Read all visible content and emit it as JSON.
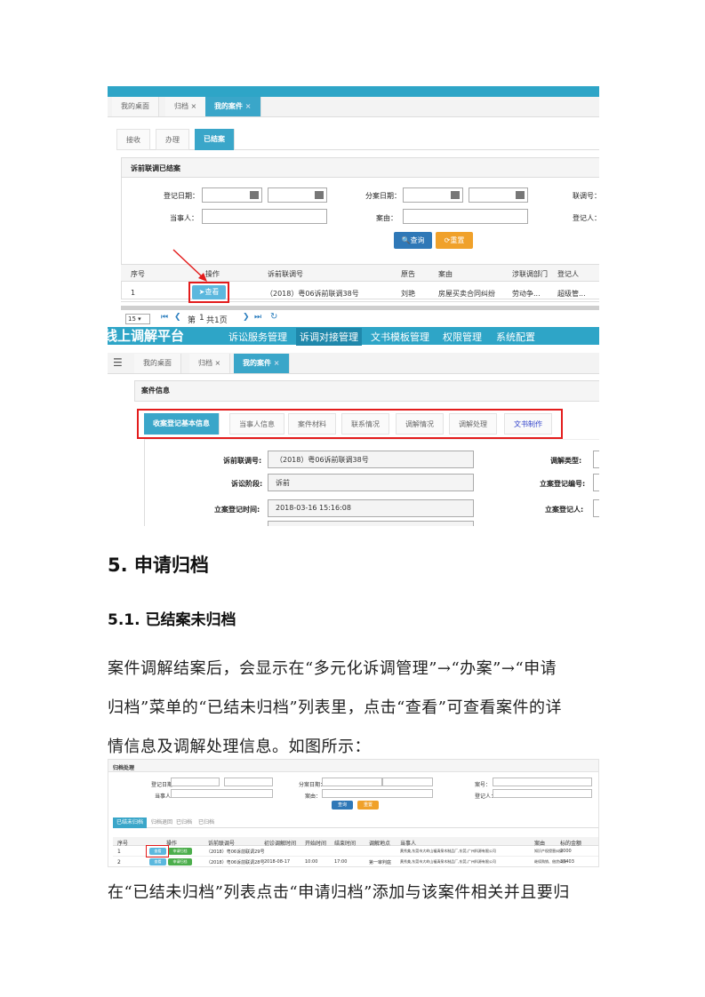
{
  "shot1": {
    "tabs": [
      "我的桌面",
      "归档",
      "我的案件"
    ],
    "subtabs": [
      "接收",
      "办理",
      "已结案"
    ],
    "section_title": "诉前联调已结案",
    "filter": {
      "reg_date": "登记日期：",
      "party": "当事人：",
      "assign_date": "分案日期：",
      "cause": "案由：",
      "mediation_no": "联调号：",
      "registrar": "登记人："
    },
    "search_btn": "查询",
    "reset_btn": "重置",
    "columns": [
      "序号",
      "操作",
      "诉前联调号",
      "原告",
      "案由",
      "涉联调部门",
      "登记人"
    ],
    "row": {
      "no": "1",
      "view_btn": "查看",
      "case_no": "（2018）粤06诉前联调38号",
      "plaintiff": "刘艳",
      "cause": "房屋买卖合同纠纷",
      "dept": "劳动争...",
      "registrar": "超级管..."
    },
    "pager": {
      "size": "15",
      "page_prefix": "第",
      "page_no": "1",
      "page_suffix": "共1页"
    }
  },
  "shot2": {
    "brand": "线上调解平台",
    "nav": [
      "诉讼服务管理",
      "诉调对接管理",
      "文书模板管理",
      "权限管理",
      "系统配置"
    ],
    "tabs": [
      "我的桌面",
      "归档",
      "我的案件"
    ],
    "section_title": "案件信息",
    "subtabs": [
      "收案登记基本信息",
      "当事人信息",
      "案件材料",
      "联系情况",
      "调解情况",
      "调解处理",
      "文书制作"
    ],
    "fields": [
      {
        "label": "诉前联调号:",
        "value": "（2018）粤06诉前联调38号"
      },
      {
        "label": "诉讼阶段:",
        "value": "诉前"
      },
      {
        "label": "立案登记时间:",
        "value": "2018-03-16 15:16:08"
      }
    ],
    "right_labels": [
      "调解类型:",
      "立案登记编号:",
      "立案登记人:"
    ]
  },
  "doc": {
    "h1": "5. 申请归档",
    "h2": "5.1.  已结案未归档",
    "para": [
      "案件调解结案后，会显示在“多元化诉调管理”→“办案”→“申请",
      "归档”菜单的“已结未归档”列表里，点击“查看”可查看案件的详",
      "情信息及调解处理信息。如图所示："
    ],
    "para2": "在“已结未归档”列表点击“申请归档”添加与该案件相关并且要归"
  },
  "shot3": {
    "title": "归档处理",
    "filter": {
      "reg_date": "登记日期：",
      "party": "当事人：",
      "assign_date": "分案日期：",
      "cause": "案由：",
      "case_no": "案号：",
      "registrar": "登记人："
    },
    "search_btn": "查询",
    "reset_btn": "重置",
    "tabs": [
      "已结未归档",
      "归档退回",
      "已归档",
      "已归档"
    ],
    "columns": [
      "序号",
      "操作",
      "诉前联调号",
      "初诊调解时间",
      "开始时间",
      "结束时间",
      "调解地点",
      "当事人",
      "案由",
      "标的金额"
    ],
    "rows": [
      {
        "no": "1",
        "view": "查看",
        "archive": "申请归档",
        "case_no": "（2018）粤06诉前联调29号",
        "t1": "",
        "t2": "",
        "t3": "",
        "place": "",
        "party": "黄秀美,东莞市大岭山福清泉木制品厂,东莞,广州科源有限公司",
        "cause": "知识产权侵害纠纷",
        "amount": "2000"
      },
      {
        "no": "2",
        "view": "查看",
        "archive": "申请归档",
        "case_no": "（2018）粤06诉前联调28号",
        "t1": "2018-08-17",
        "t2": "10:00",
        "t3": "17:00",
        "place": "第一审判庭",
        "party": "黄秀美,东莞市大岭山福清泉木制品厂,东莞,广州科源有限公司",
        "cause": "继续购销、借贷纠纷",
        "amount": "33403"
      }
    ]
  }
}
